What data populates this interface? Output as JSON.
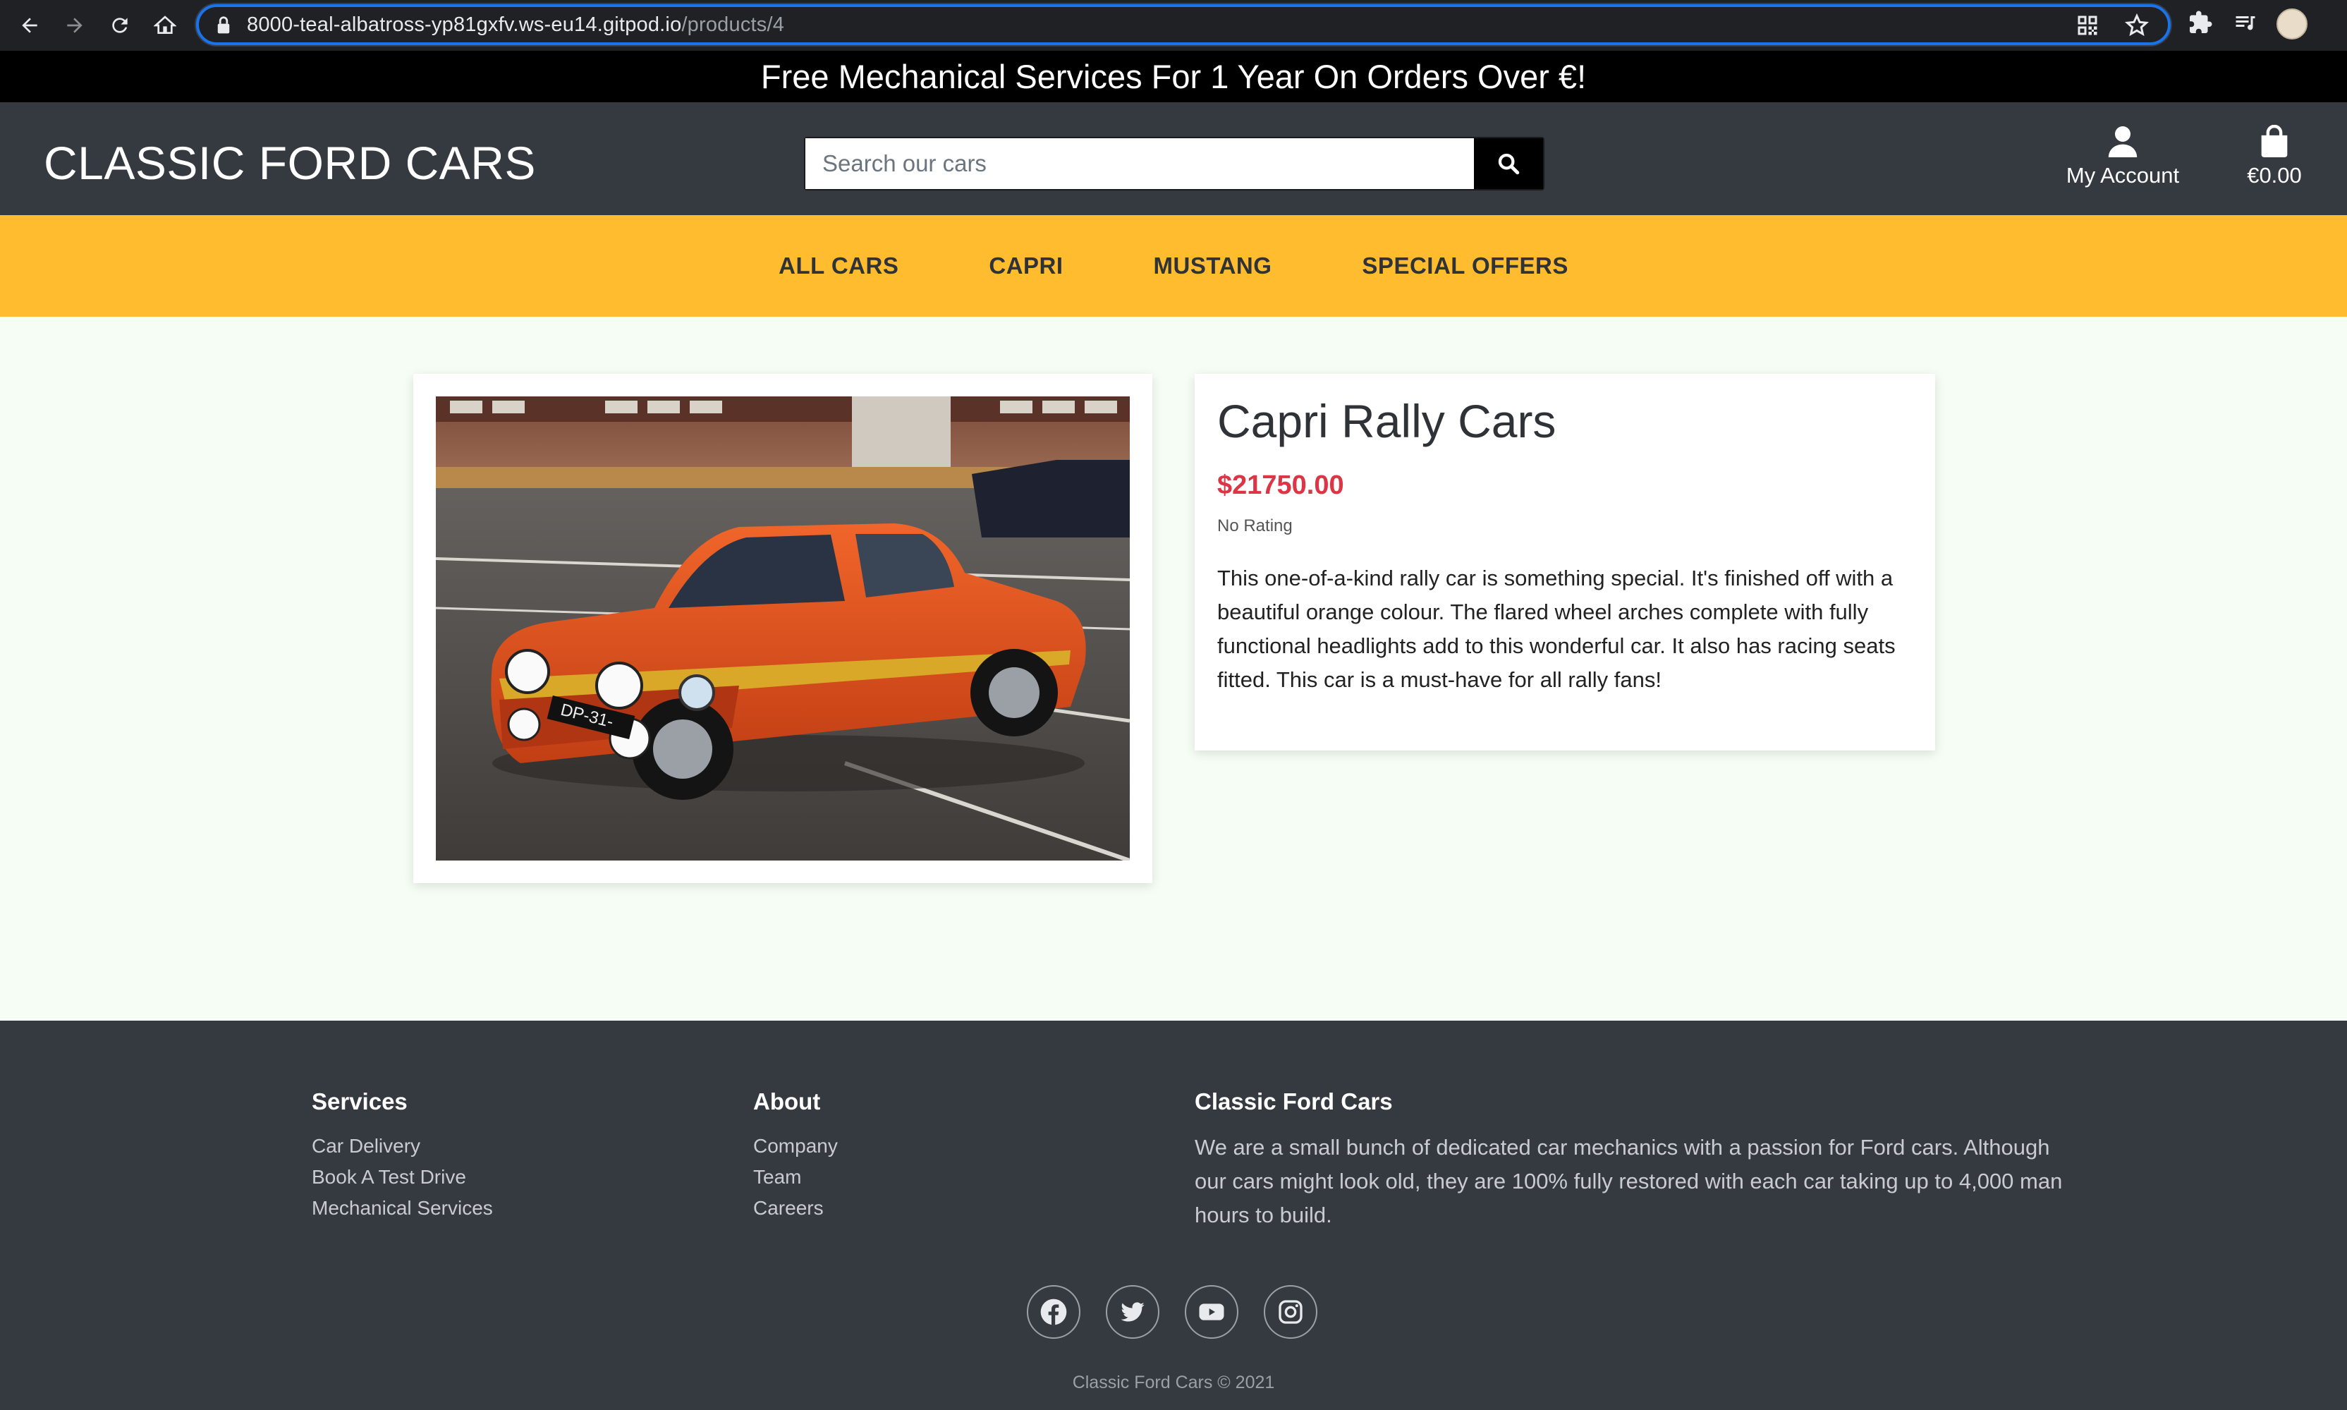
{
  "browser": {
    "url_host": "8000-teal-albatross-yp81gxfv.ws-eu14.gitpod.io",
    "url_path": "/products/4"
  },
  "promo": {
    "text": "Free Mechanical Services For 1 Year On Orders Over €!"
  },
  "header": {
    "brand": "CLASSIC FORD CARS",
    "search_placeholder": "Search our cars",
    "account_label": "My Account",
    "bag_total": "€0.00"
  },
  "nav": {
    "items": [
      {
        "label": "ALL CARS"
      },
      {
        "label": "CAPRI"
      },
      {
        "label": "MUSTANG"
      },
      {
        "label": "SPECIAL OFFERS"
      }
    ]
  },
  "product": {
    "title": "Capri Rally Cars",
    "price": "$21750.00",
    "rating": "No Rating",
    "description": "This one-of-a-kind rally car is something special. It's finished off with a beautiful orange colour. The flared wheel arches complete with fully functional headlights add to this wonderful car. It also has racing seats fitted. This car is a must-have for all rally fans!",
    "plate_text": "DP-31-"
  },
  "footer": {
    "services": {
      "heading": "Services",
      "links": [
        "Car Delivery",
        "Book A Test Drive",
        "Mechanical Services"
      ]
    },
    "about": {
      "heading": "About",
      "links": [
        "Company",
        "Team",
        "Careers"
      ]
    },
    "company": {
      "heading": "Classic Ford Cars",
      "text": "We are a small bunch of dedicated car mechanics with a passion for Ford cars. Although our cars might look old, they are 100% fully restored with each car taking up to 4,000 man hours to build."
    },
    "copyright": "Classic Ford Cars © 2021"
  }
}
